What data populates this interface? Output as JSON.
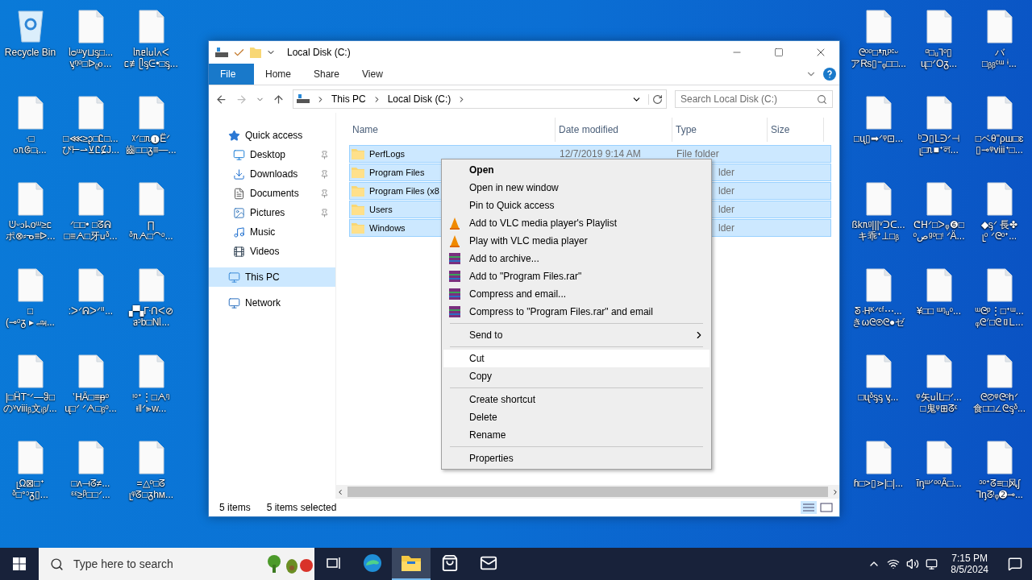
{
  "desktop": {
    "left_columns": [
      [
        {
          "kind": "recycle",
          "lines": [
            "Recycle Bin"
          ]
        },
        {
          "kind": "file",
          "lines": [
            "ᐧ□",
            "ᦞᥰᱜ□ᵢ..."
          ]
        },
        {
          "kind": "file",
          "lines": [
            "ᕫᵕ᧑ᖺoᵚ≥ᥴ",
            "ポ⊗⸗ᓀ≡ᐅ..."
          ]
        },
        {
          "kind": "file",
          "lines": [
            "□",
            "(⊸ᵒᵹ ▸ அ..."
          ]
        },
        {
          "kind": "file",
          "lines": [
            "|□ḦT⁼ᐟ—ჵ□",
            "のᵛviiiᵦ文ᵢᵦ/..."
          ]
        },
        {
          "kind": "file",
          "lines": [
            "ᥨΩ⊠□ᐩ",
            "ᵟ□ᐤᵓᵹ▯..."
          ]
        }
      ],
      [
        {
          "kind": "file",
          "lines": [
            "ᥣᴑᵚy⊔ᶊ□...",
            "ᶌᵑᵒ□ᐅᵨᦞ..."
          ]
        },
        {
          "kind": "file",
          "lines": [
            "□⋘≥ᶗ□Ꮭ□...",
            "ぴ⊢⇀⊻Ꮭ⊈J..."
          ]
        },
        {
          "kind": "file",
          "lines": [
            "ᐟ□□• □ᘔᕱ",
            "□≡ᗅ□牙ᥙᵟ..."
          ]
        },
        {
          "kind": "file",
          "lines": [
            ":ᐳᐟᕱᐳᐟᐦ..."
          ]
        },
        {
          "kind": "file",
          "lines": [
            "ʽᕼÄ□≡ᵽᵒ",
            "ᶙ□ᐟ ᐟᗅ□ᵦᵒ..."
          ]
        },
        {
          "kind": "file",
          "lines": [
            "□ʌ⟞ᘔ≠...",
            "ᵋᵋ≥ᵝ□□ᐟ..."
          ]
        }
      ],
      [
        {
          "kind": "file",
          "lines": [
            "ᥣᥰᥱᥣᥙᥣ∧ᐸ",
            "ᥴ≢ᥫᶊᕮ•□ᶊ..."
          ]
        },
        {
          "kind": "file",
          "lines": [
            "ᵡᐟ□ᥰ❶Ëᐟ",
            "齒□□ᵹ≡—..."
          ]
        },
        {
          "kind": "file",
          "lines": [
            "∏",
            "ᵟᥰᗅ□◠ᵒ..."
          ]
        },
        {
          "kind": "file",
          "lines": [
            "▞▚ᒯᑎᐸ⊘",
            "ᥑᵓb□Nᥣ..."
          ]
        },
        {
          "kind": "file",
          "lines": [
            "ᵎᵒᐩ⋮□ᗅᵑ",
            "ᵼ‖ᐟ⫸w..."
          ]
        },
        {
          "kind": "file",
          "lines": [
            "=△ᵒ□ᘔ",
            "ᥨᵠᘔ□ᵹhᴍ..."
          ]
        }
      ]
    ],
    "right_columns": [
      [
        {
          "kind": "file",
          "lines": [
            "ᘓᵒᵒ□ᵜᥰᵖᶜᵕ",
            "ア₨▯⁼ᵩ□□..."
          ]
        },
        {
          "kind": "file",
          "lines": [
            "□ᶙ▯➡ᐟᵠ⊡..."
          ]
        },
        {
          "kind": "file",
          "lines": [
            "ßkᥰᵍ|||ᵛᑐᑕ...",
            "キ乖ᐩ⊥□ᵦ"
          ]
        },
        {
          "kind": "file",
          "lines": [
            "ᘕ·ᕼᴷᐟᶜᶠ⋯...",
            "きωᘓ⊛ᘓ●ゼ"
          ]
        },
        {
          "kind": "file",
          "lines": [
            "□ᶙᵟᶊᶊ ᶌ..."
          ]
        },
        {
          "kind": "file",
          "lines": [
            "ɦ□>▯⋗|□|..."
          ]
        }
      ],
      [
        {
          "kind": "file",
          "lines": [
            "ᵅ□ᵤ⅂ᵒ▯",
            "ᶙ□ᐟOᵹ..."
          ]
        },
        {
          "kind": "file",
          "lines": [
            "ᵇᑐ▯ᒪᕭᐟ⊣",
            "ᥨ□ᥰ■ᐩল..."
          ]
        },
        {
          "kind": "file",
          "lines": [
            "ᕦᕼᐟ□ᐳᵩ❻□",
            "ᵒصᵍᵒ□ᵎ ᐟÄ..."
          ]
        },
        {
          "kind": "file",
          "lines": [
            "¥□□ ᵚᵑᵤᵒ..."
          ]
        },
        {
          "kind": "file",
          "lines": [
            "ᵠ矢ᥙᥣᒪ□ᐟ...",
            "□鬼ᵠ⊞ᘔᵋ"
          ]
        },
        {
          "kind": "file",
          "lines": [
            "ĩᶇᵚᐟᵒᵒÃ□..."
          ]
        }
      ],
      [
        {
          "kind": "file",
          "lines": [
            "バ",
            "□ᵦᵦᶜᵚ ᶤ..."
          ]
        },
        {
          "kind": "file",
          "lines": [
            "□ベθ\"ρш□ɛ",
            "▯⊸ᵠviiiᐩ□..."
          ]
        },
        {
          "kind": "file",
          "lines": [
            "◆ᶊᐟ 長✤",
            "ᥨᵒ ᐟᘓᵒᐩ..."
          ]
        },
        {
          "kind": "file",
          "lines": [
            "ᵚᘓᵖ⋮□ᐩᵚ...",
            "ᵩᘓᐟ□ᘓ▯ᒪ..."
          ]
        },
        {
          "kind": "file",
          "lines": [
            "ᘓ⊘ᵠᘓᵒhᐟ",
            "食□□∠ᘓᶊᵟ..."
          ]
        },
        {
          "kind": "file",
          "lines": [
            "ᵓᵒᐩᘔ≡□风ʃ",
            "ᒣᶇᘔᵎᵩ➋⊸..."
          ]
        }
      ]
    ]
  },
  "window": {
    "title": "Local Disk (C:)",
    "ribbon_tabs": [
      {
        "label": "File",
        "selected": true
      },
      {
        "label": "Home",
        "selected": false
      },
      {
        "label": "Share",
        "selected": false
      },
      {
        "label": "View",
        "selected": false
      }
    ],
    "breadcrumb": [
      "This PC",
      "Local Disk (C:)"
    ],
    "search": {
      "placeholder": "Search Local Disk (C:)"
    },
    "nav": [
      {
        "label": "Quick access",
        "pinned": false,
        "selected": false
      },
      {
        "label": "Desktop",
        "pinned": true,
        "selected": false
      },
      {
        "label": "Downloads",
        "pinned": true,
        "selected": false
      },
      {
        "label": "Documents",
        "pinned": true,
        "selected": false
      },
      {
        "label": "Pictures",
        "pinned": true,
        "selected": false
      },
      {
        "label": "Music",
        "pinned": false,
        "selected": false
      },
      {
        "label": "Videos",
        "pinned": false,
        "selected": false
      },
      {
        "label": "This PC",
        "pinned": false,
        "selected": true
      },
      {
        "label": "Network",
        "pinned": false,
        "selected": false
      }
    ],
    "files": {
      "columns": [
        "Name",
        "Date modified",
        "Type",
        "Size"
      ],
      "rows": [
        {
          "name": "PerfLogs",
          "date": "12/7/2019 9:14 AM",
          "type": "File folder",
          "selected": true
        },
        {
          "name": "Program Files",
          "type": "lder",
          "type_cut": true,
          "selected": true
        },
        {
          "name": "Program Files (x8",
          "type": "lder",
          "type_cut": true,
          "selected": true
        },
        {
          "name": "Users",
          "type": "lder",
          "type_cut": true,
          "selected": true
        },
        {
          "name": "Windows",
          "type": "lder",
          "type_cut": true,
          "selected": true
        }
      ]
    },
    "status_bar": {
      "count": "5 items",
      "selection": "5 items selected"
    }
  },
  "context_menu": {
    "items": [
      {
        "kind": "item",
        "label": "Open",
        "bold": true
      },
      {
        "kind": "item",
        "label": "Open in new window"
      },
      {
        "kind": "item",
        "label": "Pin to Quick access"
      },
      {
        "kind": "vlc",
        "label": "Add to VLC media player's Playlist"
      },
      {
        "kind": "vlc",
        "label": "Play with VLC media player"
      },
      {
        "kind": "rar",
        "label": "Add to archive..."
      },
      {
        "kind": "rar",
        "label": "Add to \"Program Files.rar\""
      },
      {
        "kind": "rar",
        "label": "Compress and email..."
      },
      {
        "kind": "rar",
        "label": "Compress to \"Program Files.rar\" and email"
      },
      {
        "kind": "separator"
      },
      {
        "kind": "submenu",
        "label": "Send to"
      },
      {
        "kind": "separator"
      },
      {
        "kind": "item",
        "label": "Cut",
        "highlighted": true
      },
      {
        "kind": "item",
        "label": "Copy"
      },
      {
        "kind": "separator"
      },
      {
        "kind": "item",
        "label": "Create shortcut"
      },
      {
        "kind": "item",
        "label": "Delete"
      },
      {
        "kind": "item",
        "label": "Rename"
      },
      {
        "kind": "separator"
      },
      {
        "kind": "item",
        "label": "Properties"
      }
    ]
  },
  "taskbar": {
    "search": {
      "placeholder": "Type here to search"
    },
    "apps": [
      {
        "active": false
      },
      {
        "active": false
      },
      {
        "active": true
      },
      {
        "active": false
      },
      {
        "active": false
      }
    ],
    "time": "7:15 PM",
    "date": "8/5/2024"
  }
}
